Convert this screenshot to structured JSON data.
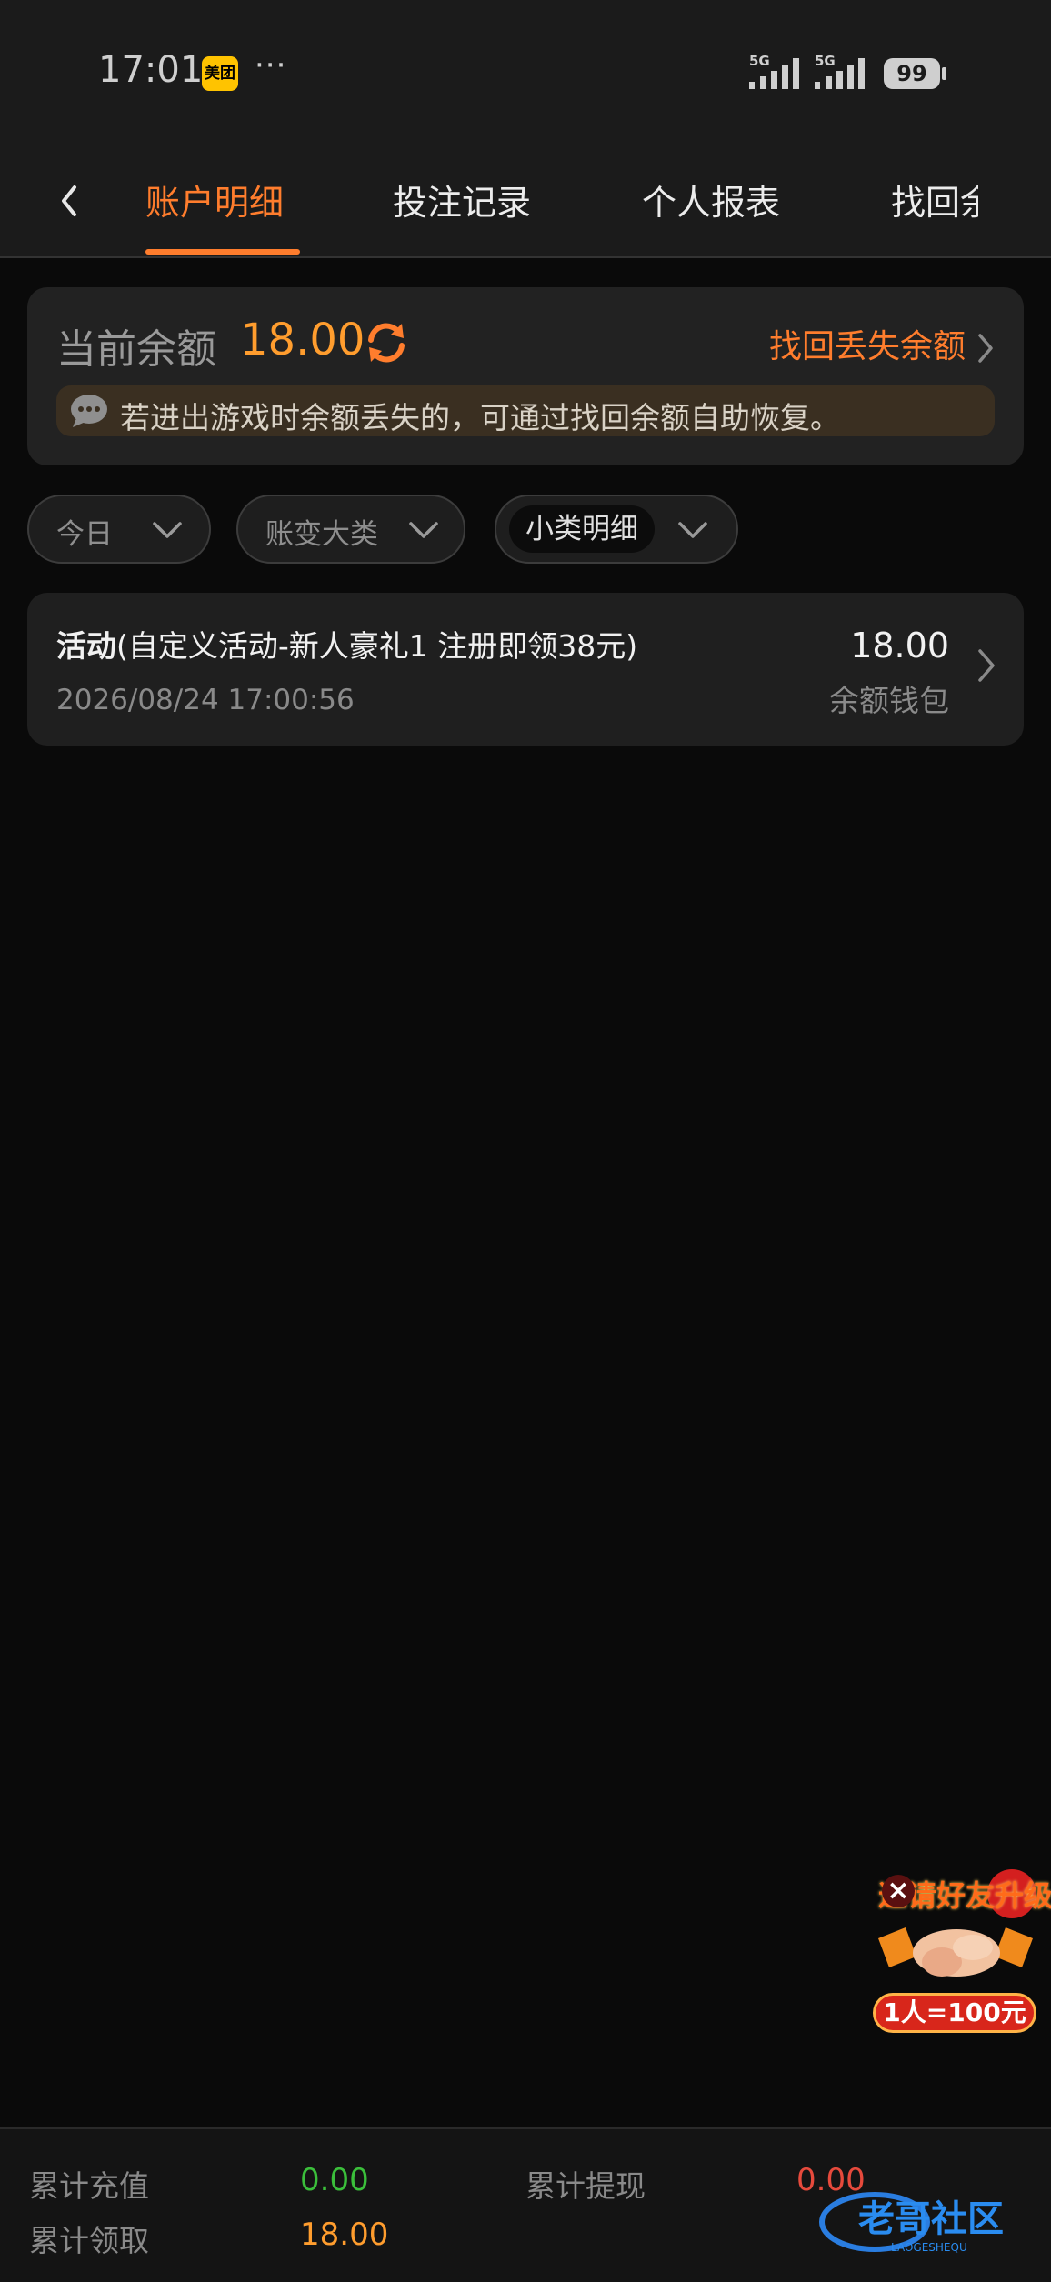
{
  "status_bar": {
    "time": "17:01",
    "app_badge": "美团",
    "more_dots": "···",
    "network_1": "5G",
    "network_2": "5G",
    "battery": "99"
  },
  "nav": {
    "back_icon": "chevron-left-icon",
    "tabs": [
      {
        "label": "账户明细",
        "active": true
      },
      {
        "label": "投注记录",
        "active": false
      },
      {
        "label": "个人报表",
        "active": false
      },
      {
        "label": "找回余额",
        "active": false
      }
    ]
  },
  "balance": {
    "label": "当前余额",
    "value": "18.00",
    "refresh_icon": "refresh-icon",
    "recover_link": "找回丢失余额",
    "notice": "若进出游戏时余额丢失的，可通过找回余额自助恢复。"
  },
  "filters": [
    {
      "label": "今日",
      "selected": false
    },
    {
      "label": "账变大类",
      "selected": false
    },
    {
      "label": "小类明细",
      "selected": true
    }
  ],
  "transactions": [
    {
      "category": "活动",
      "detail": "(自定义活动-新人豪礼1 注册即领38元)",
      "datetime": "2026/08/24 17:00:56",
      "amount": "18.00",
      "wallet": "余额钱包"
    }
  ],
  "promo": {
    "title": "邀请好友升级",
    "close": "×",
    "reward": "1人=100元"
  },
  "summary": {
    "recharge_label": "累计充值",
    "recharge_value": "0.00",
    "withdraw_label": "累计提现",
    "withdraw_value": "0.00",
    "claimed_label": "累计领取",
    "claimed_value": "18.00"
  },
  "watermark": {
    "text": "老哥社区",
    "subtext": "LAOGESHEQU"
  },
  "colors": {
    "accent": "#ff7d2d",
    "balance": "#ff9d2e",
    "positive": "#3bbf3b",
    "negative": "#e64a3c",
    "claimed": "#ff9d2e"
  }
}
